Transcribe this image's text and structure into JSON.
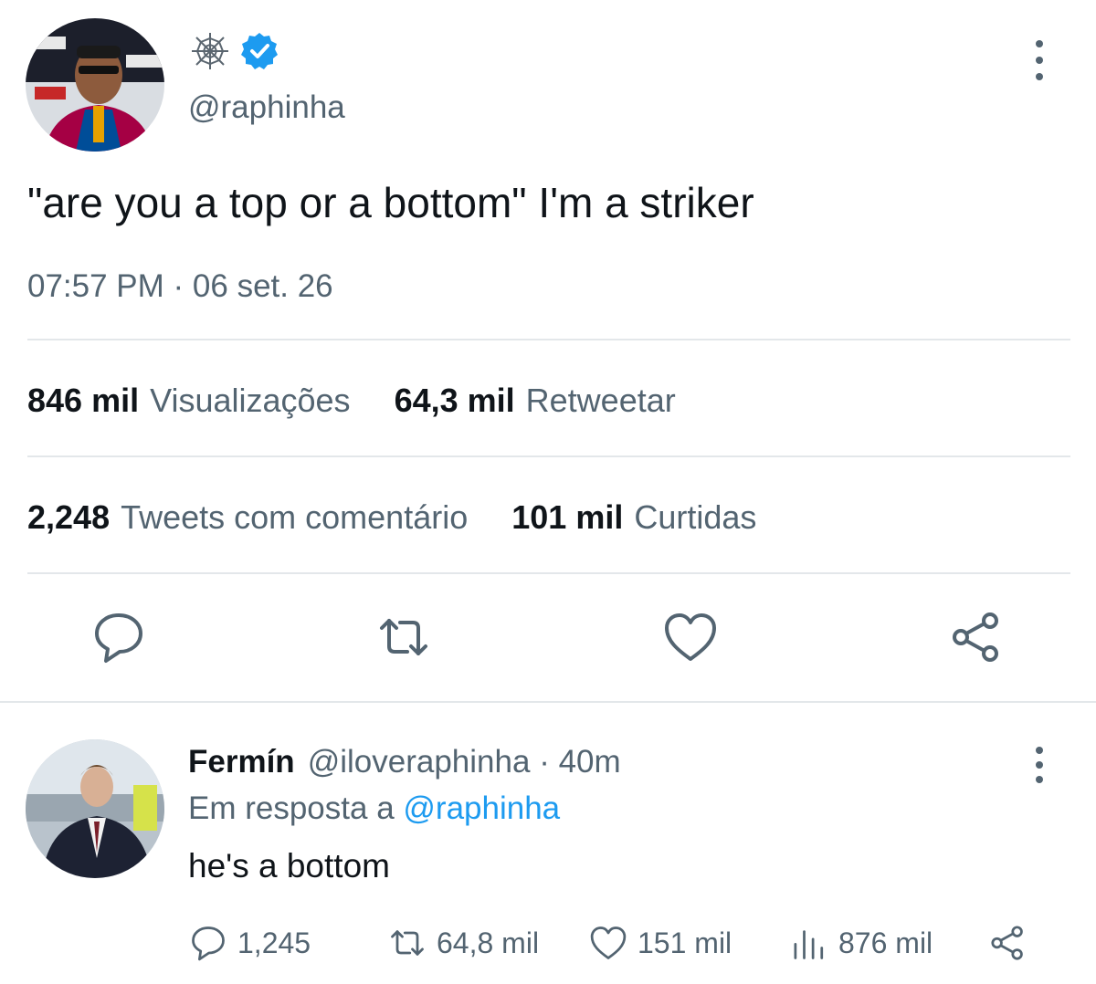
{
  "main_tweet": {
    "badge_icon": "cobweb-icon",
    "verified_icon": "verified-badge-icon",
    "handle": "@raphinha",
    "text": "\"are you a top or a bottom\" I'm a striker",
    "timestamp": "07:57 PM · 06 set. 26"
  },
  "stats": {
    "views": {
      "value": "846 mil",
      "label": "Visualizações"
    },
    "retweets": {
      "value": "64,3 mil",
      "label": "Retweetar"
    },
    "quotes": {
      "value": "2,248",
      "label": "Tweets com comentário"
    },
    "likes": {
      "value": "101 mil",
      "label": "Curtidas"
    }
  },
  "actions": [
    "reply-icon",
    "retweet-icon",
    "like-icon",
    "share-icon"
  ],
  "reply": {
    "name": "Fermín",
    "handle": "@iloveraphinha",
    "time": "· 40m",
    "in_reply_prefix": "Em resposta a ",
    "in_reply_to": "@raphinha",
    "text": "he's a bottom",
    "counts": {
      "replies": "1,245",
      "retweets": "64,8 mil",
      "likes": "151 mil",
      "views": "876 mil"
    }
  },
  "colors": {
    "accent": "#1d9bf0",
    "text": "#0f1419",
    "secondary": "#536471",
    "divider": "#e3e7ea"
  }
}
